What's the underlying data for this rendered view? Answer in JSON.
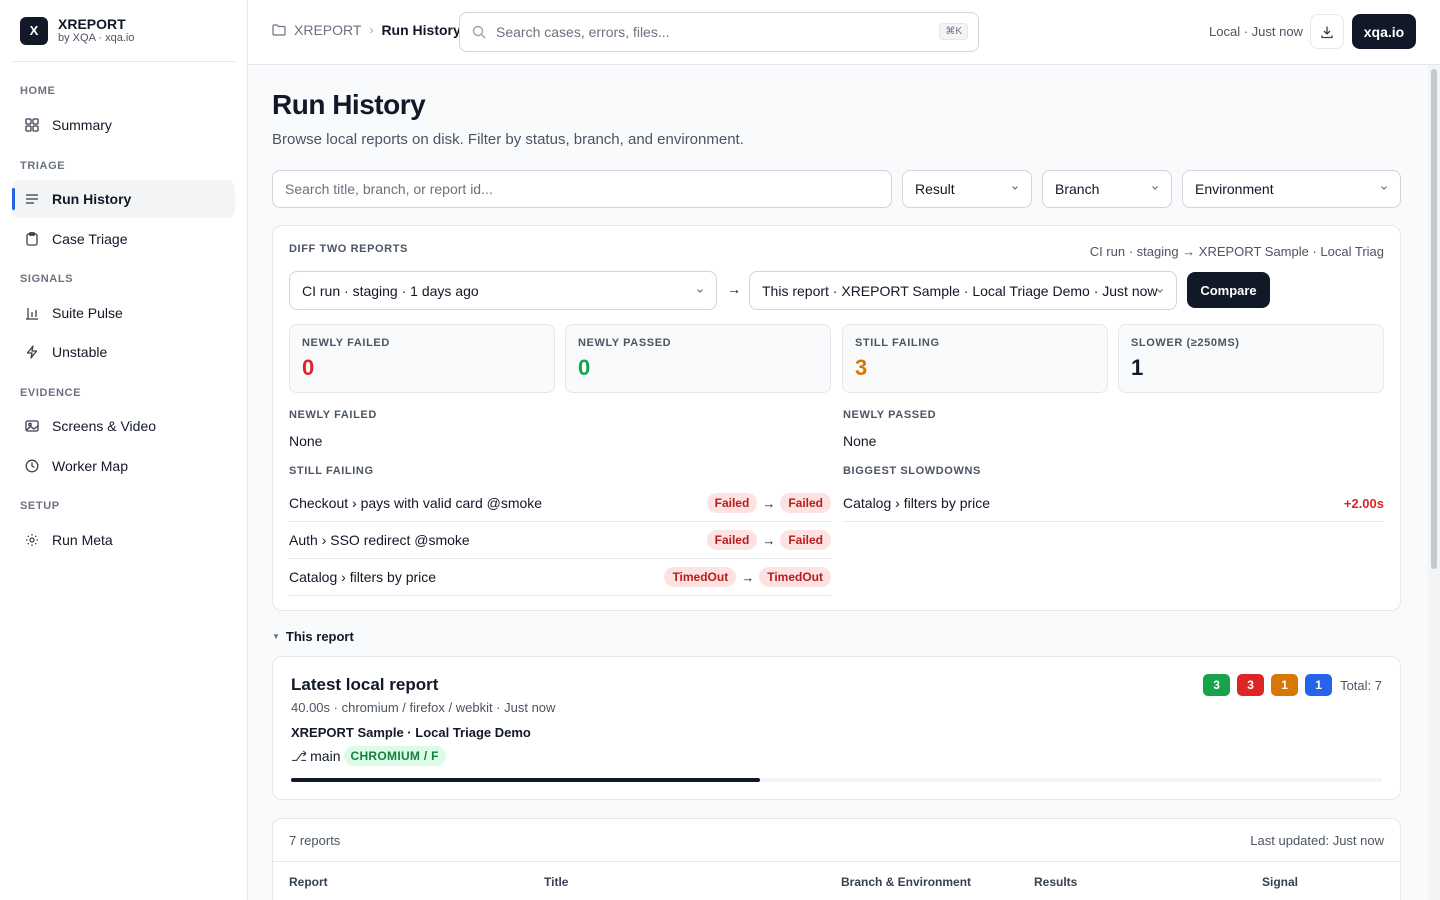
{
  "brand": {
    "logo": "X",
    "name": "XREPORT",
    "sub": "by XQA · xqa.io"
  },
  "sidebar": {
    "groups": {
      "home": "HOME",
      "triage": "TRIAGE",
      "signals": "SIGNALS",
      "evidence": "EVIDENCE",
      "setup": "SETUP"
    },
    "items": [
      {
        "label": "Summary",
        "icon": "grid-icon"
      },
      {
        "label": "Run History",
        "icon": "list-icon",
        "active": true
      },
      {
        "label": "Case Triage",
        "icon": "clipboard-icon"
      },
      {
        "label": "Suite Pulse",
        "icon": "bar-chart-icon"
      },
      {
        "label": "Unstable",
        "icon": "bolt-icon"
      },
      {
        "label": "Screens & Video",
        "icon": "image-icon"
      },
      {
        "label": "Worker Map",
        "icon": "clock-icon"
      },
      {
        "label": "Run Meta",
        "icon": "gear-icon"
      }
    ]
  },
  "topbar": {
    "breadcrumb_root": "XREPORT",
    "breadcrumb_sep": "›",
    "breadcrumb_current": "Run History",
    "search_placeholder": "Search cases, errors, files...",
    "shortcut": "⌘K",
    "status": "Local · Just now",
    "xqa_button": "xqa.io"
  },
  "page": {
    "title": "Run History",
    "subtitle": "Browse local reports on disk. Filter by status, branch, and environment."
  },
  "filters": {
    "search_placeholder": "Search title, branch, or report id...",
    "result": "Result",
    "branch": "Branch",
    "environment": "Environment"
  },
  "diff": {
    "heading": "DIFF TWO REPORTS",
    "summary": "CI run · staging → XREPORT Sample · Local Triag",
    "left_select": "CI run · staging · 1 days ago",
    "arrow": "→",
    "right_select": "This report · XREPORT Sample · Local Triage Demo · Just now",
    "compare_label": "Compare",
    "stats": [
      {
        "label": "NEWLY FAILED",
        "value": "0",
        "color": "#dc2626"
      },
      {
        "label": "NEWLY PASSED",
        "value": "0",
        "color": "#16a34a"
      },
      {
        "label": "STILL FAILING",
        "value": "3",
        "color": "#d97706"
      },
      {
        "label": "SLOWER (≥250MS)",
        "value": "1",
        "color": "#111827"
      }
    ],
    "newly_failed_heading": "NEWLY FAILED",
    "newly_failed_text": "None",
    "newly_passed_heading": "NEWLY PASSED",
    "newly_passed_text": "None",
    "still_failing_heading": "STILL FAILING",
    "still_failing": [
      {
        "name": "Checkout › pays with valid card @smoke",
        "from": "Failed",
        "to": "Failed"
      },
      {
        "name": "Auth › SSO redirect @smoke",
        "from": "Failed",
        "to": "Failed"
      },
      {
        "name": "Catalog › filters by price",
        "from": "TimedOut",
        "to": "TimedOut"
      }
    ],
    "slowdowns_heading": "BIGGEST SLOWDOWNS",
    "slowdowns": [
      {
        "name": "Catalog › filters by price",
        "delta": "+2.00s"
      }
    ]
  },
  "this_report": {
    "toggle_label": "This report",
    "card_title": "Latest local report",
    "meta": "40.00s · chromium / firefox / webkit · Just now",
    "name": "XREPORT Sample · Local Triage Demo",
    "branch_icon": "⎇",
    "branch": "main",
    "env_badge": "CHROMIUM / F",
    "badges": [
      {
        "value": "3",
        "color": "#16a34a"
      },
      {
        "value": "3",
        "color": "#dc2626"
      },
      {
        "value": "1",
        "color": "#d97706"
      },
      {
        "value": "1",
        "color": "#2563eb"
      }
    ],
    "total": "Total: 7",
    "progress_fraction": 0.43
  },
  "reports_table": {
    "count": "7 reports",
    "last_updated": "Last updated: Just now",
    "columns": [
      "Report",
      "Title",
      "Branch & Environment",
      "Results",
      "Signal"
    ]
  }
}
